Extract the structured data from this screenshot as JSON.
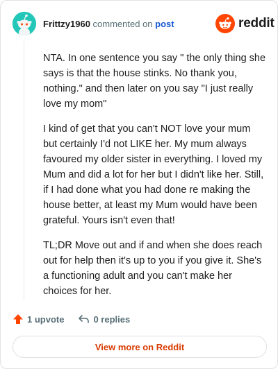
{
  "header": {
    "username": "Frittzy1960",
    "commented_text": "commented on",
    "post_link": "post"
  },
  "brand": {
    "name": "reddit",
    "icon": "reddit-snoo-icon",
    "color": "#ff4500"
  },
  "comment": {
    "paragraphs": [
      "NTA. In one sentence you say \" the only thing she says is that the house stinks. No thank you, nothing.\" and then later on you say \"I just really love my mom\"",
      "I kind of get that you can't NOT love your mum but certainly I'd not LIKE her. My mum always favoured my older sister in everything. I loved my Mum and did a lot for her but I didn't like her. Still, if I had done what you had done re making the house better, at least my Mum would have been grateful. Yours isn't even that!",
      "TL;DR Move out and if and when she does reach out for help then it's up to you if you give it. She's a functioning adult and you can't make her choices for her."
    ]
  },
  "actions": {
    "upvote_label": "1 upvote",
    "upvote_icon": "upvote-arrow-icon",
    "upvote_color": "#ff4500",
    "replies_label": "0 replies",
    "reply_icon": "reply-arrow-icon"
  },
  "footer": {
    "view_more_label": "View more on Reddit",
    "view_more_color": "#d93a00"
  },
  "colors": {
    "avatar_bg": "#22c7b8",
    "link": "#1a5bd6"
  }
}
